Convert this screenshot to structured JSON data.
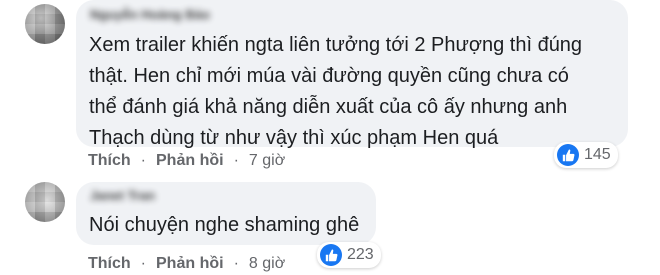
{
  "comments": [
    {
      "author": "Nguyễn Hoàng Bảo",
      "text": "Xem trailer khiến ngta liên tưởng tới 2 Phượng thì đúng\nthật. Hen chỉ mới múa vài đường quyền cũng chưa có\nthể đánh giá khả năng diễn xuất của cô ấy nhưng anh\nThạch dùng từ như vậy thì xúc phạm Hen quá",
      "like_label": "Thích",
      "reply_label": "Phản hồi",
      "time": "7 giờ",
      "reaction_count": "145"
    },
    {
      "author": "Janet Tran",
      "text": "Nói chuyện nghe shaming ghê",
      "like_label": "Thích",
      "reply_label": "Phản hồi",
      "time": "8 giờ",
      "reaction_count": "223"
    }
  ],
  "colors": {
    "bubble": "#f0f2f5",
    "meta_text": "#65676b",
    "like_blue": "#1877f2"
  },
  "icons": {
    "reaction": "thumbs-up-icon",
    "dot": "·"
  }
}
